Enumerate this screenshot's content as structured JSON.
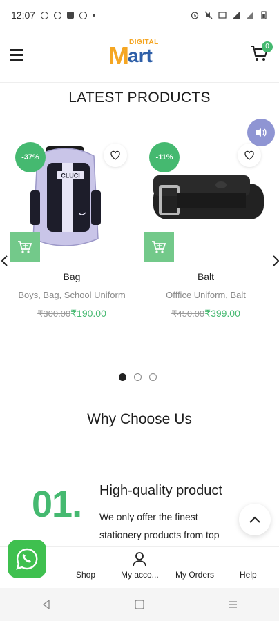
{
  "status_bar": {
    "time": "12:07"
  },
  "header": {
    "logo_top": "DIGITAL",
    "logo_m": "M",
    "logo_art": "art",
    "cart_count": "0"
  },
  "section_title": "LATEST PRODUCTS",
  "products": [
    {
      "discount": "-37%",
      "name": "Bag",
      "categories": "Boys, Bag, School Uniform",
      "old_price": "₹300.00",
      "price": "₹190.00"
    },
    {
      "discount": "-11%",
      "name": "Balt",
      "categories": "Offfice Uniform, Balt",
      "old_price": "₹450.00",
      "price": "₹399.00"
    }
  ],
  "carousel": {
    "pages": 3,
    "active": 1
  },
  "why_title": "Why Choose Us",
  "feature": {
    "number": "01.",
    "title": "High-quality product",
    "text": "We only offer the finest stationery products from top"
  },
  "bottom_nav": {
    "shop": "Shop",
    "account": "My acco...",
    "orders": "My Orders",
    "help": "Help"
  },
  "colors": {
    "accent": "#45b970",
    "brand_orange": "#f5a623",
    "brand_blue": "#2e5fa8"
  }
}
